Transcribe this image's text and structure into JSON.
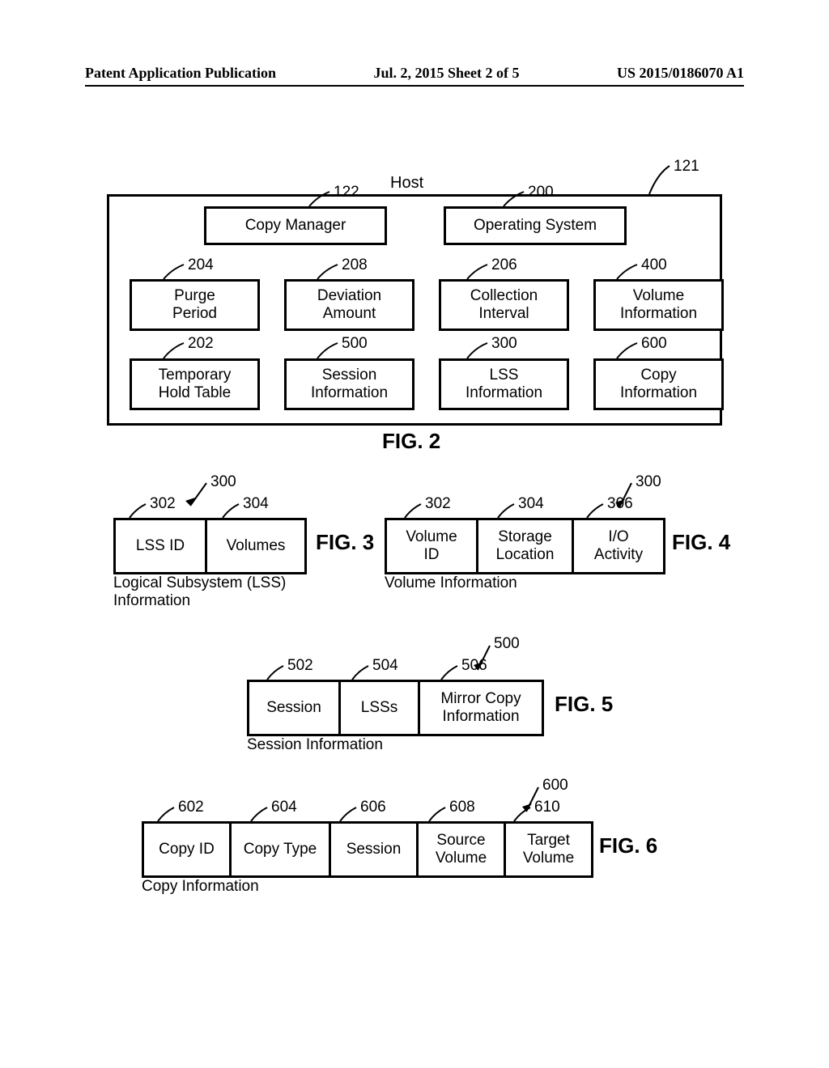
{
  "header": {
    "left": "Patent Application Publication",
    "center": "Jul. 2, 2015  Sheet 2 of 5",
    "right": "US 2015/0186070 A1"
  },
  "fig2": {
    "host_label": "Host",
    "callouts": {
      "host": "121",
      "copy_manager": "122",
      "os": "200",
      "purge": "204",
      "deviation": "208",
      "collection": "206",
      "volume_info": "400",
      "temp_table": "202",
      "session_info": "500",
      "lss_info": "300",
      "copy_info": "600"
    },
    "boxes": {
      "copy_manager": "Copy Manager",
      "os": "Operating System",
      "purge": "Purge\nPeriod",
      "deviation": "Deviation\nAmount",
      "collection": "Collection\nInterval",
      "volume_info": "Volume\nInformation",
      "temp_table": "Temporary\nHold Table",
      "session_info": "Session\nInformation",
      "lss_info": "LSS\nInformation",
      "copy_info": "Copy\nInformation"
    },
    "label": "FIG. 2"
  },
  "fig3": {
    "callouts": {
      "main": "300",
      "c1": "302",
      "c2": "304"
    },
    "cells": {
      "c1": "LSS ID",
      "c2": "Volumes"
    },
    "caption": "Logical Subsystem (LSS)\nInformation",
    "label": "FIG. 3"
  },
  "fig4": {
    "callouts": {
      "main": "300",
      "c1": "302",
      "c2": "304",
      "c3": "306"
    },
    "cells": {
      "c1": "Volume\nID",
      "c2": "Storage\nLocation",
      "c3": "I/O\nActivity"
    },
    "caption": "Volume Information",
    "label": "FIG. 4"
  },
  "fig5": {
    "callouts": {
      "main": "500",
      "c1": "502",
      "c2": "504",
      "c3": "506"
    },
    "cells": {
      "c1": "Session",
      "c2": "LSSs",
      "c3": "Mirror Copy\nInformation"
    },
    "caption": "Session Information",
    "label": "FIG. 5"
  },
  "fig6": {
    "callouts": {
      "main": "600",
      "c1": "602",
      "c2": "604",
      "c3": "606",
      "c4": "608",
      "c5": "610"
    },
    "cells": {
      "c1": "Copy ID",
      "c2": "Copy Type",
      "c3": "Session",
      "c4": "Source\nVolume",
      "c5": "Target\nVolume"
    },
    "caption": "Copy Information",
    "label": "FIG. 6"
  }
}
